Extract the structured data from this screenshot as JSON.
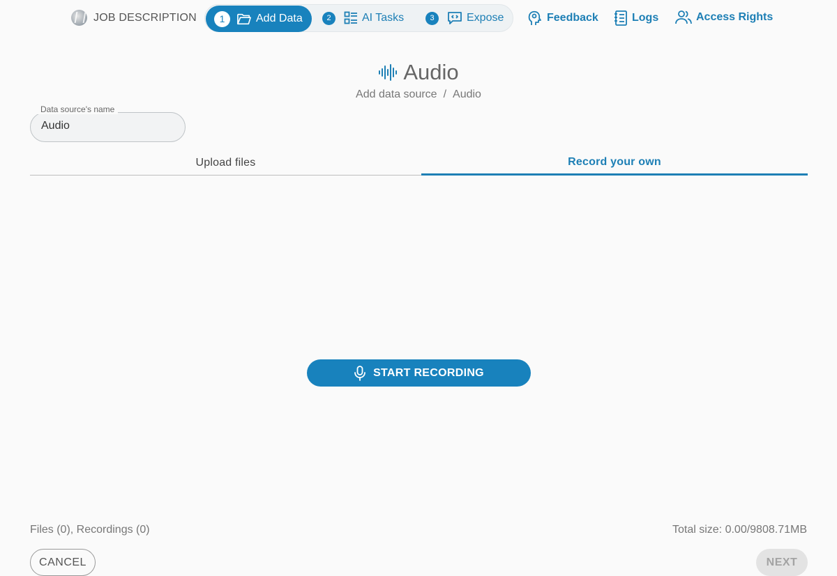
{
  "header": {
    "job_label": "JOB DESCRIPTION",
    "steps": [
      {
        "number": "1",
        "label": "Add Data",
        "icon": "folder-open-icon",
        "active": true
      },
      {
        "number": "2",
        "label": "AI Tasks",
        "icon": "list-grid-icon",
        "active": false
      },
      {
        "number": "3",
        "label": "Expose",
        "icon": "code-chat-icon",
        "active": false
      }
    ],
    "nav": {
      "feedback": "Feedback",
      "logs": "Logs",
      "access_rights": "Access Rights"
    }
  },
  "page": {
    "title": "Audio",
    "title_icon": "audio-waveform-icon",
    "breadcrumb": {
      "parent": "Add data source",
      "separator": "/",
      "current": "Audio"
    }
  },
  "form": {
    "name_label": "Data source's name",
    "name_value": "Audio"
  },
  "tabs": {
    "upload": "Upload files",
    "record": "Record your own",
    "active": "record"
  },
  "record": {
    "button_label": "START RECORDING",
    "icon": "microphone-icon"
  },
  "footer": {
    "counts": "Files (0), Recordings (0)",
    "total_size": "Total size: 0.00/9808.71MB",
    "cancel_label": "CANCEL",
    "next_label": "NEXT"
  },
  "colors": {
    "primary": "#1882bd",
    "link": "#1d7fb5",
    "disabled_bg": "#e3e3e3"
  }
}
